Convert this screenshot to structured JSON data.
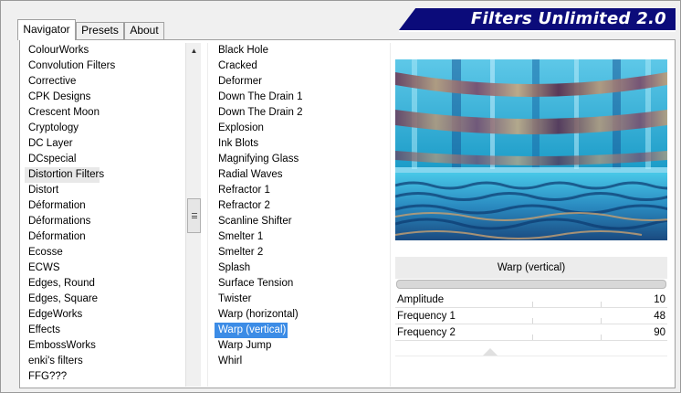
{
  "title": "Filters Unlimited 2.0",
  "tabs": [
    {
      "label": "Navigator",
      "active": true
    },
    {
      "label": "Presets",
      "active": false
    },
    {
      "label": "About",
      "active": false
    }
  ],
  "categories": [
    "ColourWorks",
    "Convolution Filters",
    "Corrective",
    "CPK Designs",
    "Crescent Moon",
    "Cryptology",
    "DC Layer",
    "DCspecial",
    "Distortion Filters",
    "Distort",
    "Déformation",
    "Déformations",
    "Déformation",
    "Ecosse",
    "ECWS",
    "Edges, Round",
    "Edges, Square",
    "EdgeWorks",
    "Effects",
    "EmbossWorks",
    "enki's filters",
    "FFG???"
  ],
  "selected_category": "Distortion Filters",
  "filters": [
    "Black Hole",
    "Cracked",
    "Deformer",
    "Down The Drain 1",
    "Down The Drain 2",
    "Explosion",
    "Ink Blots",
    "Magnifying Glass",
    "Radial Waves",
    "Refractor 1",
    "Refractor 2",
    "Scanline Shifter",
    "Smelter 1",
    "Smelter 2",
    "Splash",
    "Surface Tension",
    "Twister",
    "Warp (horizontal)",
    "Warp (vertical)",
    "Warp Jump",
    "Whirl"
  ],
  "selected_filter": "Warp (vertical)",
  "filter_name": "Warp (vertical)",
  "params": [
    {
      "label": "Amplitude",
      "value": "10"
    },
    {
      "label": "Frequency 1",
      "value": "48"
    },
    {
      "label": "Frequency 2",
      "value": "90"
    }
  ],
  "icons": {
    "scroll_up": "up-arrow-icon",
    "scroll_grip": "grip-icon"
  }
}
